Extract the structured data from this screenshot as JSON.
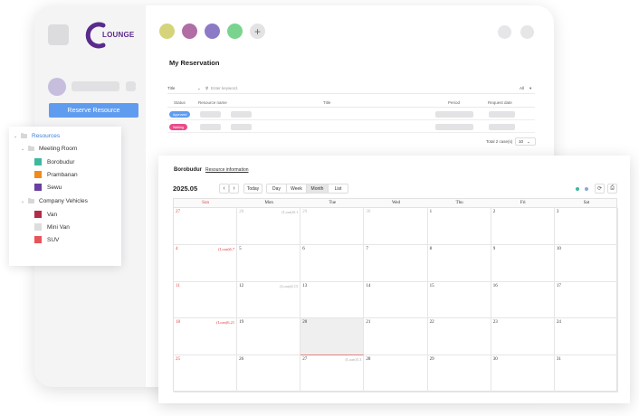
{
  "sidebar": {
    "logo": {
      "mark": "C",
      "text": "LOUNGE"
    },
    "reserve_button": "Reserve Resource"
  },
  "topbar": {
    "colors": [
      "#d6d47b",
      "#b06ea4",
      "#8c7ac7",
      "#7ad48f"
    ],
    "add_icon": "+"
  },
  "reservation": {
    "title": "My Reservation",
    "filter_label": "Title",
    "search_placeholder": "Enter keyword.",
    "all_label": "All",
    "columns": [
      "Status",
      "Resource name",
      "Title",
      "Period",
      "Request date"
    ],
    "rows": [
      {
        "status": "Approved",
        "status_color": "#5f9cf0"
      },
      {
        "status": "Waiting",
        "status_color": "#ea4b8a"
      }
    ],
    "total_text": "Total 2 case(s)",
    "page_size": "10"
  },
  "resources": {
    "root": "Resources",
    "groups": [
      {
        "name": "Meeting Room",
        "items": [
          {
            "name": "Borobudur",
            "color": "#3fb8a0"
          },
          {
            "name": "Prambanan",
            "color": "#f08b1b"
          },
          {
            "name": "Sewu",
            "color": "#6a3fa0"
          }
        ]
      },
      {
        "name": "Company Vehicles",
        "items": [
          {
            "name": "Van",
            "color": "#b22c4a"
          },
          {
            "name": "Mini Van",
            "color": "#dddddd"
          },
          {
            "name": "SUV",
            "color": "#e8545a"
          }
        ]
      }
    ]
  },
  "calendar": {
    "room": "Borobudur",
    "info_link": "Resource information",
    "month": "2025.05",
    "today": "Today",
    "views": [
      "Day",
      "Week",
      "Month",
      "List"
    ],
    "active_view": "Month",
    "legend_colors": [
      "#3fb8a0",
      "#8da6d8"
    ],
    "weekdays": [
      "Sun",
      "Mon",
      "Tue",
      "Wed",
      "Thu",
      "Fri",
      "Sat"
    ],
    "weeks": [
      [
        {
          "d": "27",
          "other": true
        },
        {
          "d": "28",
          "other": true,
          "ev": "(Loan)0.1"
        },
        {
          "d": "29",
          "other": true
        },
        {
          "d": "30",
          "other": true
        },
        {
          "d": "1"
        },
        {
          "d": "2"
        },
        {
          "d": "3"
        }
      ],
      [
        {
          "d": "4",
          "ev": "(Loan)6.7"
        },
        {
          "d": "5"
        },
        {
          "d": "6"
        },
        {
          "d": "7"
        },
        {
          "d": "8"
        },
        {
          "d": "9"
        },
        {
          "d": "10"
        }
      ],
      [
        {
          "d": "11"
        },
        {
          "d": "12",
          "ev": "(Loan)4.15"
        },
        {
          "d": "13"
        },
        {
          "d": "14"
        },
        {
          "d": "15"
        },
        {
          "d": "16"
        },
        {
          "d": "17"
        }
      ],
      [
        {
          "d": "18",
          "ev": "(Loan)6.21"
        },
        {
          "d": "19"
        },
        {
          "d": "20",
          "today": true
        },
        {
          "d": "21"
        },
        {
          "d": "22"
        },
        {
          "d": "23"
        },
        {
          "d": "24"
        }
      ],
      [
        {
          "d": "25"
        },
        {
          "d": "26"
        },
        {
          "d": "27",
          "ev": "(Loan)5.3"
        },
        {
          "d": "28"
        },
        {
          "d": "29"
        },
        {
          "d": "30"
        },
        {
          "d": "31"
        }
      ]
    ]
  }
}
